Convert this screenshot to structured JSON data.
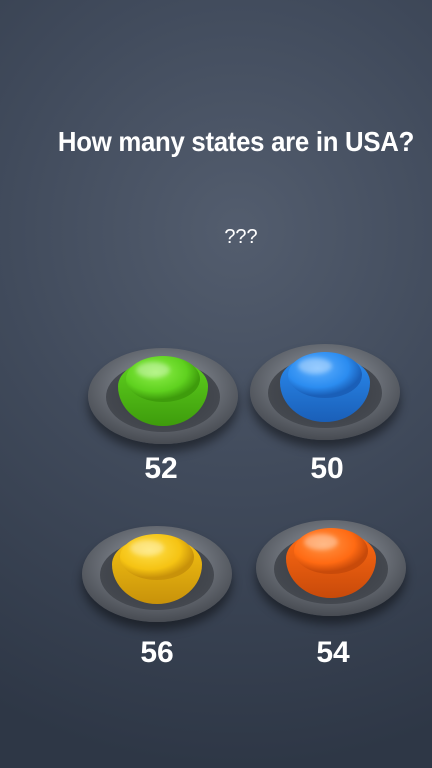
{
  "question": "How many states are in USA?",
  "hint": "???",
  "answers": [
    {
      "label": "52",
      "color": "#5fd11f",
      "highlight": "#8ef04a",
      "shade": "#3e9c0c"
    },
    {
      "label": "50",
      "color": "#2b8cf0",
      "highlight": "#5fb0ff",
      "shade": "#1a5fb8"
    },
    {
      "label": "56",
      "color": "#f5c313",
      "highlight": "#ffe04a",
      "shade": "#c8920a"
    },
    {
      "label": "54",
      "color": "#ff6a13",
      "highlight": "#ff9445",
      "shade": "#c84a0a"
    }
  ]
}
